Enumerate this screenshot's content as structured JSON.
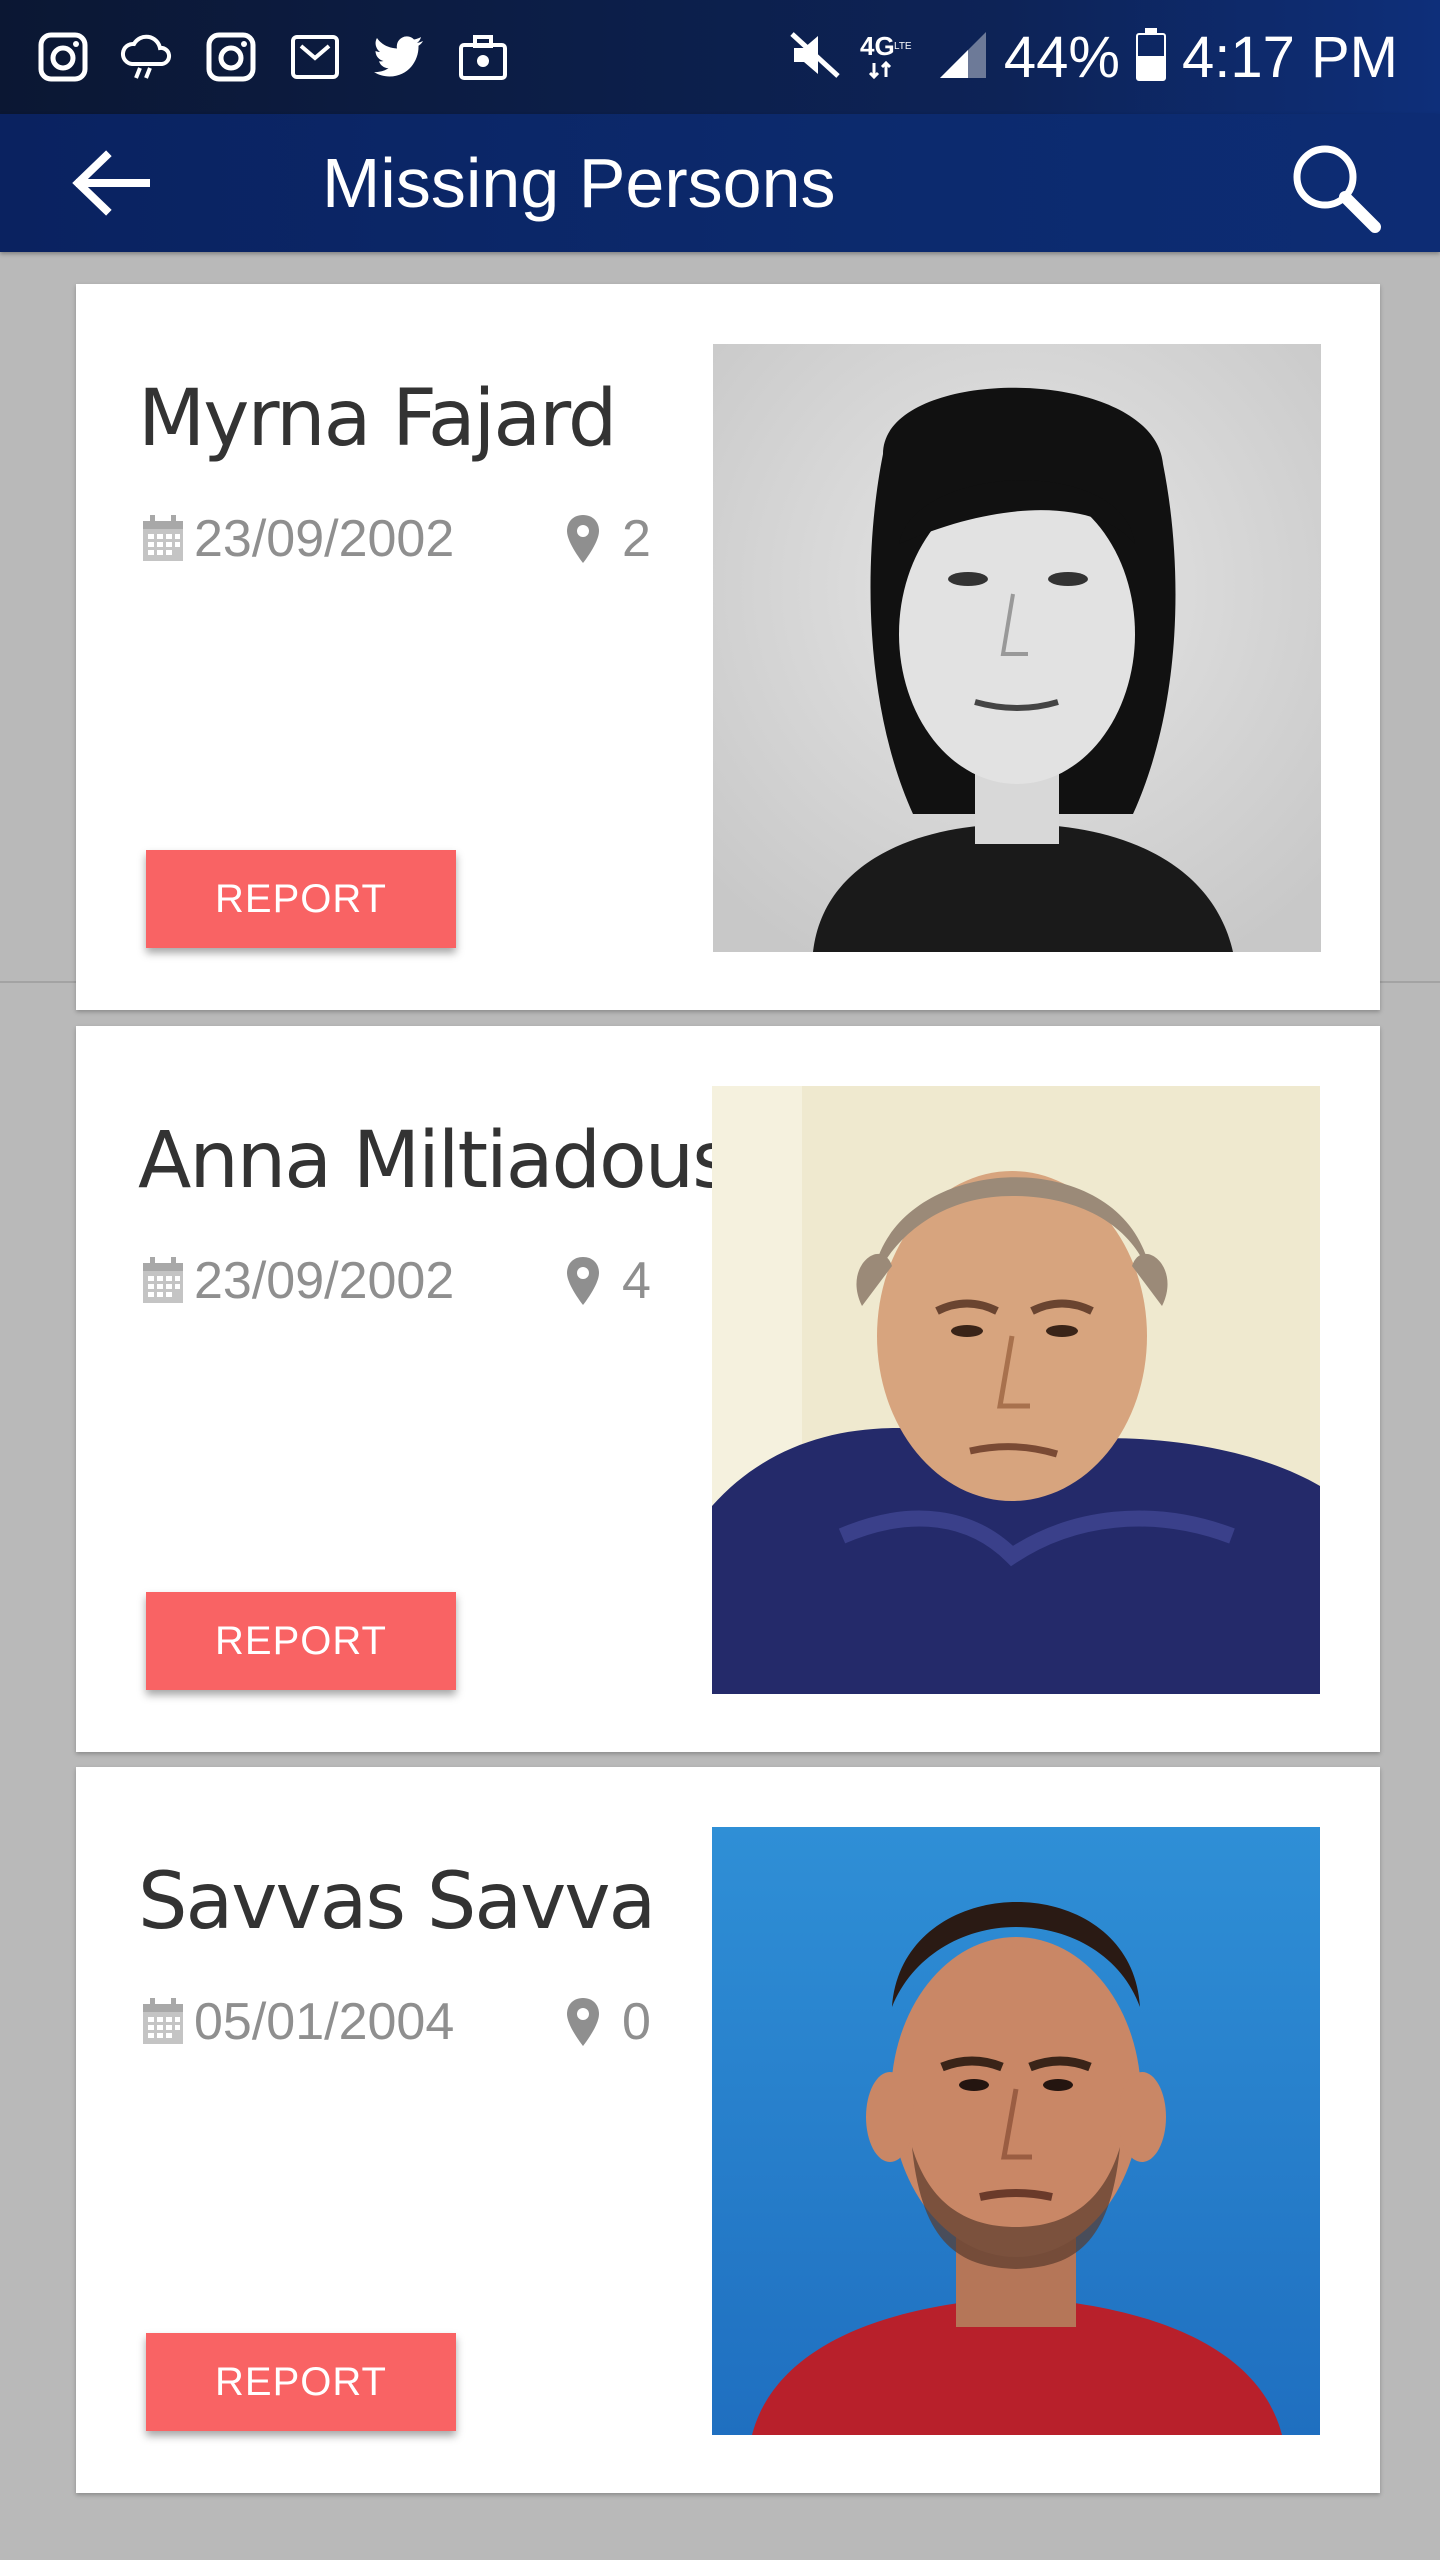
{
  "status_bar": {
    "battery": "44%",
    "time": "4:17 PM",
    "network": "4G LTE",
    "left_icons": [
      "instagram-icon",
      "cloud-rain-icon",
      "instagram-icon",
      "newspaper-icon",
      "twitter-icon",
      "briefcase-icon"
    ]
  },
  "app_bar": {
    "title": "Missing Persons"
  },
  "persons": [
    {
      "name": "Myrna Fajard",
      "date": "23/09/2002",
      "count": "2",
      "report_label": "REPORT"
    },
    {
      "name": "Anna Miltiadous",
      "date": "23/09/2002",
      "count": "4",
      "report_label": "REPORT"
    },
    {
      "name": "Savvas Savva",
      "date": "05/01/2004",
      "count": "0",
      "report_label": "REPORT"
    }
  ],
  "colors": {
    "app_bar": "#0c2a6d",
    "report_button": "#f96364",
    "background": "#b9b9b9"
  }
}
